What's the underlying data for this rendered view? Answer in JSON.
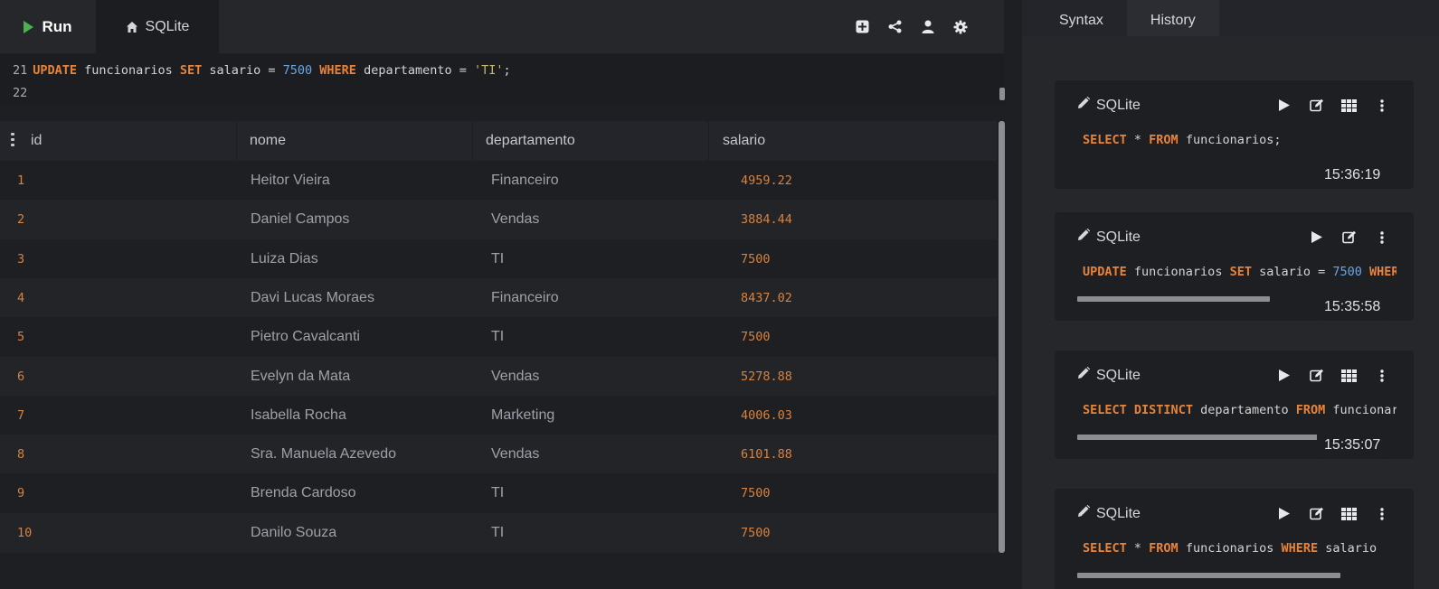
{
  "toolbar": {
    "run_label": "Run",
    "db_tab_label": "SQLite",
    "icons": [
      "plus-square-icon",
      "share-icon",
      "user-icon",
      "gear-icon"
    ]
  },
  "editor": {
    "lines": [
      {
        "number": "21",
        "tokens": [
          {
            "t": "UPDATE",
            "k": "kw"
          },
          {
            "t": " funcionarios ",
            "k": ""
          },
          {
            "t": "SET",
            "k": "kw"
          },
          {
            "t": " salario = ",
            "k": ""
          },
          {
            "t": "7500",
            "k": "num"
          },
          {
            "t": " ",
            "k": ""
          },
          {
            "t": "WHERE",
            "k": "kw"
          },
          {
            "t": " departamento = ",
            "k": ""
          },
          {
            "t": "'TI'",
            "k": "str"
          },
          {
            "t": ";",
            "k": ""
          }
        ]
      },
      {
        "number": "22",
        "tokens": []
      }
    ]
  },
  "results": {
    "columns": [
      "id",
      "nome",
      "departamento",
      "salario"
    ],
    "rows": [
      {
        "id": "1",
        "nome": "Heitor Vieira",
        "departamento": "Financeiro",
        "salario": "4959.22"
      },
      {
        "id": "2",
        "nome": "Daniel Campos",
        "departamento": "Vendas",
        "salario": "3884.44"
      },
      {
        "id": "3",
        "nome": "Luiza Dias",
        "departamento": "TI",
        "salario": "7500"
      },
      {
        "id": "4",
        "nome": "Davi Lucas Moraes",
        "departamento": "Financeiro",
        "salario": "8437.02"
      },
      {
        "id": "5",
        "nome": "Pietro Cavalcanti",
        "departamento": "TI",
        "salario": "7500"
      },
      {
        "id": "6",
        "nome": "Evelyn da Mata",
        "departamento": "Vendas",
        "salario": "5278.88"
      },
      {
        "id": "7",
        "nome": "Isabella Rocha",
        "departamento": "Marketing",
        "salario": "4006.03"
      },
      {
        "id": "8",
        "nome": "Sra. Manuela Azevedo",
        "departamento": "Vendas",
        "salario": "6101.88"
      },
      {
        "id": "9",
        "nome": "Brenda Cardoso",
        "departamento": "TI",
        "salario": "7500"
      },
      {
        "id": "10",
        "nome": "Danilo Souza",
        "departamento": "TI",
        "salario": "7500"
      }
    ]
  },
  "side": {
    "tabs": [
      {
        "label": "Syntax",
        "active": false
      },
      {
        "label": "History",
        "active": true
      }
    ],
    "history": [
      {
        "db": "SQLite",
        "actions": [
          "play-icon",
          "edit-icon",
          "table-icon",
          "more-icon"
        ],
        "tokens": [
          {
            "t": "SELECT",
            "k": "kw"
          },
          {
            "t": " * ",
            "k": ""
          },
          {
            "t": "FROM",
            "k": "kw"
          },
          {
            "t": " funcionarios;",
            "k": ""
          }
        ],
        "time": "15:36:19",
        "scroll_fraction": null
      },
      {
        "db": "SQLite",
        "actions": [
          "play-icon",
          "edit-icon",
          "more-icon"
        ],
        "tokens": [
          {
            "t": "UPDATE",
            "k": "kw"
          },
          {
            "t": " funcionarios ",
            "k": ""
          },
          {
            "t": "SET",
            "k": "kw"
          },
          {
            "t": " salario = ",
            "k": ""
          },
          {
            "t": "7500",
            "k": "num"
          },
          {
            "t": " ",
            "k": ""
          },
          {
            "t": "WHERE",
            "k": "kw"
          }
        ],
        "time": "15:35:58",
        "scroll_fraction": 0.6
      },
      {
        "db": "SQLite",
        "actions": [
          "play-icon",
          "edit-icon",
          "table-icon",
          "more-icon"
        ],
        "tokens": [
          {
            "t": "SELECT",
            "k": "kw"
          },
          {
            "t": " ",
            "k": ""
          },
          {
            "t": "DISTINCT",
            "k": "kw"
          },
          {
            "t": " departamento ",
            "k": ""
          },
          {
            "t": "FROM",
            "k": "kw"
          },
          {
            "t": " funcionarios;",
            "k": ""
          }
        ],
        "time": "15:35:07",
        "scroll_fraction": 0.83
      },
      {
        "db": "SQLite",
        "actions": [
          "play-icon",
          "edit-icon",
          "table-icon",
          "more-icon"
        ],
        "tokens": [
          {
            "t": "SELECT",
            "k": "kw"
          },
          {
            "t": " * ",
            "k": ""
          },
          {
            "t": "FROM",
            "k": "kw"
          },
          {
            "t": " funcionarios ",
            "k": ""
          },
          {
            "t": "WHERE",
            "k": "kw"
          },
          {
            "t": " salario",
            "k": ""
          }
        ],
        "time": "",
        "scroll_fraction": 0.82
      }
    ]
  }
}
